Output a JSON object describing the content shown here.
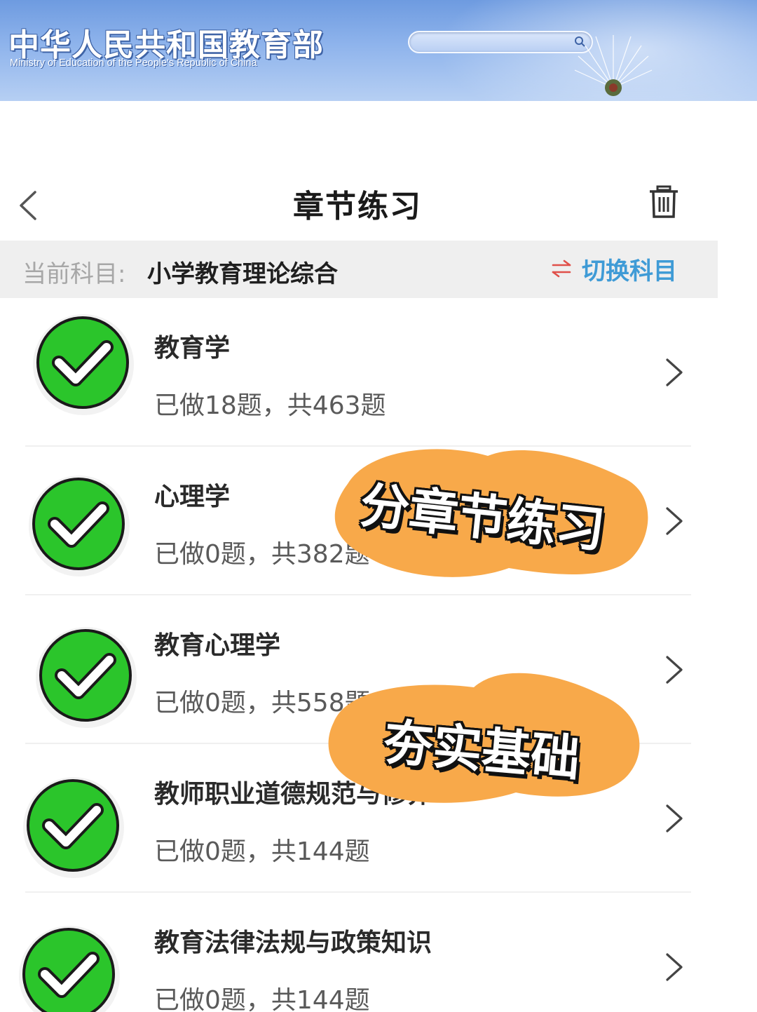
{
  "banner": {
    "title": "中华人民共和国教育部",
    "subtitle": "Ministry of Education of the People's Republic of China"
  },
  "header": {
    "title": "章节练习",
    "back_icon": "chevron-left-icon",
    "trash_icon": "trash-icon"
  },
  "subject": {
    "label": "当前科目:",
    "value": "小学教育理论综合",
    "switch_label": "切换科目",
    "switch_icon": "swap-arrows-icon"
  },
  "chapters": [
    {
      "title": "教育学",
      "progress": "已做18题，共463题"
    },
    {
      "title": "心理学",
      "progress": "已做0题，共382题"
    },
    {
      "title": "教育心理学",
      "progress": "已做0题，共558题"
    },
    {
      "title": "教师职业道德规范与修养",
      "progress": "已做0题，共144题"
    },
    {
      "title": "教育法律法规与政策知识",
      "progress": "已做0题，共144题"
    }
  ],
  "stickers": {
    "first": "分章节练习",
    "second": "夯实基础"
  },
  "colors": {
    "banner": "#7ea6e8",
    "accent_blue": "#3f9bd6",
    "accent_red": "#e0504a",
    "check_green": "#2bc52b",
    "sticker_orange": "#f8a94a"
  }
}
